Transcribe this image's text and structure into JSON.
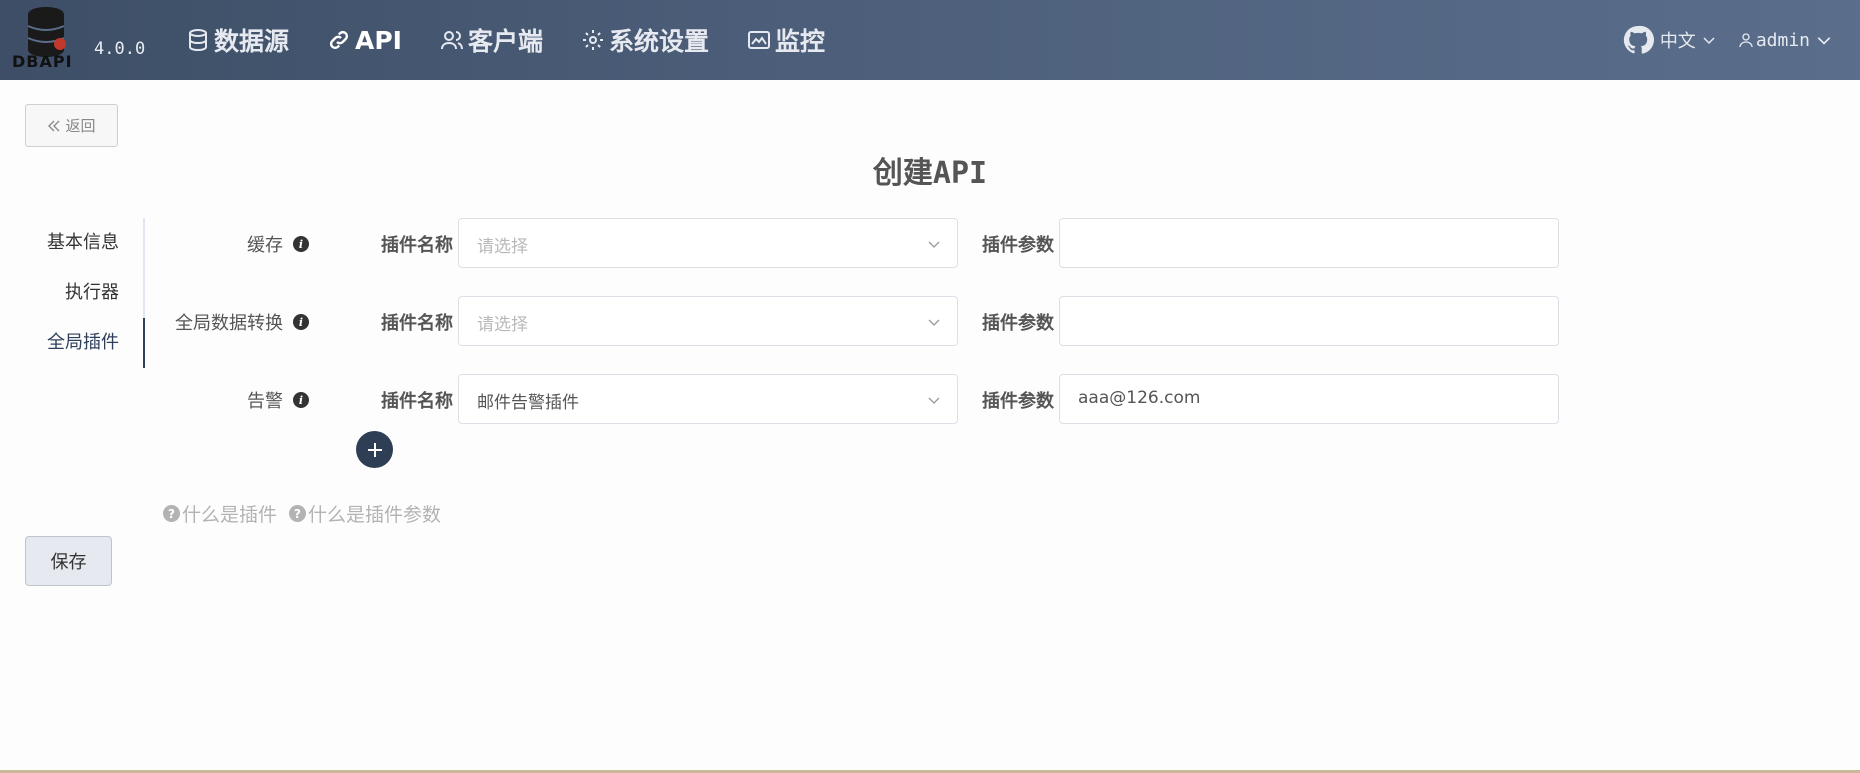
{
  "header": {
    "logo_text": "DBAPI",
    "version": "4.0.0",
    "nav": [
      {
        "label": "数据源",
        "icon": "database-icon"
      },
      {
        "label": "API",
        "icon": "link-icon"
      },
      {
        "label": "客户端",
        "icon": "users-icon"
      },
      {
        "label": "系统设置",
        "icon": "gear-icon"
      },
      {
        "label": "监控",
        "icon": "monitor-icon"
      }
    ],
    "language": "中文",
    "user": "admin"
  },
  "back_button": "返回",
  "page_title": {
    "prefix": "创建",
    "suffix": "API"
  },
  "side_menu": [
    "基本信息",
    "执行器",
    "全局插件"
  ],
  "plugin_rows": [
    {
      "label": "缓存",
      "name_label": "插件名称",
      "name_value": "请选择",
      "name_is_placeholder": true,
      "param_label": "插件参数",
      "param_value": ""
    },
    {
      "label": "全局数据转换",
      "name_label": "插件名称",
      "name_value": "请选择",
      "name_is_placeholder": true,
      "param_label": "插件参数",
      "param_value": ""
    },
    {
      "label": "告警",
      "name_label": "插件名称",
      "name_value": "邮件告警插件",
      "name_is_placeholder": false,
      "param_label": "插件参数",
      "param_value": "aaa@126.com"
    }
  ],
  "help_links": [
    "什么是插件",
    "什么是插件参数"
  ],
  "save_button": "保存",
  "colors": {
    "header": "#4b5d78",
    "accent": "#2d3e55",
    "placeholder": "#b9b9b9"
  }
}
